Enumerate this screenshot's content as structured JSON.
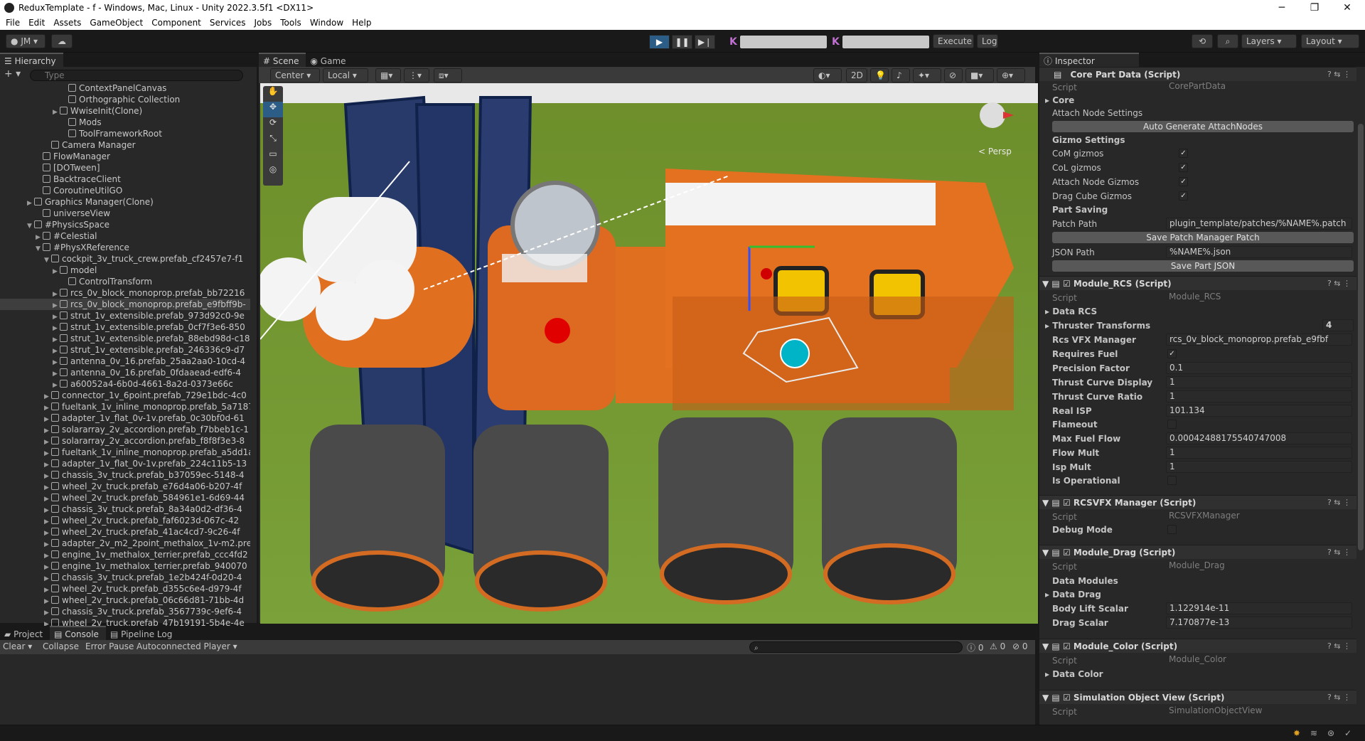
{
  "window": {
    "title": "ReduxTemplate - f - Windows, Mac, Linux - Unity 2022.3.5f1 <DX11>"
  },
  "menu": [
    "File",
    "Edit",
    "Assets",
    "GameObject",
    "Component",
    "Services",
    "Jobs",
    "Tools",
    "Window",
    "Help"
  ],
  "toolbar": {
    "account": "JM ▾",
    "execute": "Execute",
    "log": "Log",
    "layers": "Layers",
    "layout": "Layout"
  },
  "hierarchy": {
    "title": "Hierarchy",
    "search_placeholder": "Type",
    "rows": [
      {
        "text": "ContextPanelCanvas",
        "indent": 7,
        "arrow": ""
      },
      {
        "text": "Orthographic Collection",
        "indent": 7,
        "arrow": ""
      },
      {
        "text": "WwiseInit(Clone)",
        "indent": 6,
        "arrow": "▶"
      },
      {
        "text": "Mods",
        "indent": 7,
        "arrow": ""
      },
      {
        "text": "ToolFrameworkRoot",
        "indent": 7,
        "arrow": ""
      },
      {
        "text": "Camera Manager",
        "indent": 5,
        "arrow": ""
      },
      {
        "text": "FlowManager",
        "indent": 4,
        "arrow": ""
      },
      {
        "text": "[DOTween]",
        "indent": 4,
        "arrow": ""
      },
      {
        "text": "BacktraceClient",
        "indent": 4,
        "arrow": ""
      },
      {
        "text": "CoroutineUtilGO",
        "indent": 4,
        "arrow": ""
      },
      {
        "text": "Graphics Manager(Clone)",
        "indent": 3,
        "arrow": "▶"
      },
      {
        "text": "universeView",
        "indent": 4,
        "arrow": ""
      },
      {
        "text": "#PhysicsSpace",
        "indent": 3,
        "arrow": "▼"
      },
      {
        "text": "#Celestial",
        "indent": 4,
        "arrow": "▶"
      },
      {
        "text": "#PhysXReference",
        "indent": 4,
        "arrow": "▼"
      },
      {
        "text": "cockpit_3v_truck_crew.prefab_cf2457e7-f1",
        "indent": 5,
        "arrow": "▼"
      },
      {
        "text": "model",
        "indent": 6,
        "arrow": "▶"
      },
      {
        "text": "ControlTransform",
        "indent": 7,
        "arrow": ""
      },
      {
        "text": "rcs_0v_block_monoprop.prefab_bb72216",
        "indent": 6,
        "arrow": "▶"
      },
      {
        "text": "rcs_0v_block_monoprop.prefab_e9fbff9b-",
        "indent": 6,
        "arrow": "▶",
        "selected": true
      },
      {
        "text": "strut_1v_extensible.prefab_973d92c0-9e",
        "indent": 6,
        "arrow": "▶"
      },
      {
        "text": "strut_1v_extensible.prefab_0cf7f3e6-850",
        "indent": 6,
        "arrow": "▶"
      },
      {
        "text": "strut_1v_extensible.prefab_88ebd98d-c18",
        "indent": 6,
        "arrow": "▶"
      },
      {
        "text": "strut_1v_extensible.prefab_246336c9-d7",
        "indent": 6,
        "arrow": "▶"
      },
      {
        "text": "antenna_0v_16.prefab_25aa2aa0-10cd-4",
        "indent": 6,
        "arrow": "▶"
      },
      {
        "text": "antenna_0v_16.prefab_0fdaaead-edf6-4",
        "indent": 6,
        "arrow": "▶"
      },
      {
        "text": "a60052a4-6b0d-4661-8a2d-0373e66c",
        "indent": 6,
        "arrow": "▶"
      },
      {
        "text": "connector_1v_6point.prefab_729e1bdc-4c0",
        "indent": 5,
        "arrow": "▶"
      },
      {
        "text": "fueltank_1v_inline_monoprop.prefab_5a7187",
        "indent": 5,
        "arrow": "▶"
      },
      {
        "text": "adapter_1v_flat_0v-1v.prefab_0c30bf0d-61",
        "indent": 5,
        "arrow": "▶"
      },
      {
        "text": "solararray_2v_accordion.prefab_f7bbeb1c-1",
        "indent": 5,
        "arrow": "▶"
      },
      {
        "text": "solararray_2v_accordion.prefab_f8f8f3e3-8",
        "indent": 5,
        "arrow": "▶"
      },
      {
        "text": "fueltank_1v_inline_monoprop.prefab_a5dd1a",
        "indent": 5,
        "arrow": "▶"
      },
      {
        "text": "adapter_1v_flat_0v-1v.prefab_224c11b5-13",
        "indent": 5,
        "arrow": "▶"
      },
      {
        "text": "chassis_3v_truck.prefab_b37059ec-5148-4",
        "indent": 5,
        "arrow": "▶"
      },
      {
        "text": "wheel_2v_truck.prefab_e76d4a06-b207-4f",
        "indent": 5,
        "arrow": "▶"
      },
      {
        "text": "wheel_2v_truck.prefab_584961e1-6d69-44",
        "indent": 5,
        "arrow": "▶"
      },
      {
        "text": "chassis_3v_truck.prefab_8a34a0d2-df36-4",
        "indent": 5,
        "arrow": "▶"
      },
      {
        "text": "wheel_2v_truck.prefab_faf6023d-067c-42",
        "indent": 5,
        "arrow": "▶"
      },
      {
        "text": "wheel_2v_truck.prefab_41ac4cd7-9c26-4f",
        "indent": 5,
        "arrow": "▶"
      },
      {
        "text": "adapter_2v_m2_2point_methalox_1v-m2.pre",
        "indent": 5,
        "arrow": "▶"
      },
      {
        "text": "engine_1v_methalox_terrier.prefab_ccc4fd2",
        "indent": 5,
        "arrow": "▶"
      },
      {
        "text": "engine_1v_methalox_terrier.prefab_940070",
        "indent": 5,
        "arrow": "▶"
      },
      {
        "text": "chassis_3v_truck.prefab_1e2b424f-0d20-4",
        "indent": 5,
        "arrow": "▶"
      },
      {
        "text": "wheel_2v_truck.prefab_d355c6e4-d979-4f",
        "indent": 5,
        "arrow": "▶"
      },
      {
        "text": "wheel_2v_truck.prefab_06c66d81-71bb-4d",
        "indent": 5,
        "arrow": "▶"
      },
      {
        "text": "chassis_3v_truck.prefab_3567739c-9ef6-4",
        "indent": 5,
        "arrow": "▶"
      },
      {
        "text": "wheel_2v_truck.prefab_47b19191-5b4e-4e",
        "indent": 5,
        "arrow": "▶"
      }
    ]
  },
  "scene": {
    "tabs": [
      "Scene",
      "Game"
    ],
    "pivot": "Center",
    "space": "Local",
    "mode2d": "2D",
    "persp": "< Persp"
  },
  "bottom": {
    "tabs": [
      "Project",
      "Console",
      "Pipeline Log"
    ],
    "clear": "Clear",
    "collapse": "Collapse",
    "error_pause": "Error Pause",
    "player": "Autoconnected Player",
    "counts": [
      "0",
      "0",
      "0"
    ]
  },
  "inspector": {
    "title": "Inspector",
    "core": {
      "header": "Core Part Data (Script)",
      "script_label": "Script",
      "script": "CorePartData",
      "core": "Core",
      "attach": "Attach Node Settings",
      "auto_btn": "Auto Generate AttachNodes",
      "gizmo": "Gizmo Settings",
      "com": "CoM gizmos",
      "col": "CoL gizmos",
      "attachg": "Attach Node Gizmos",
      "dragc": "Drag Cube Gizmos",
      "saving": "Part Saving",
      "patch_label": "Patch Path",
      "patch": "plugin_template/patches/%NAME%.patch",
      "save_patch": "Save Patch Manager Patch",
      "json_label": "JSON Path",
      "json": "%NAME%.json",
      "save_json": "Save Part JSON"
    },
    "rcs": {
      "header": "Module_RCS (Script)",
      "script": "Module_RCS",
      "data": "Data RCS",
      "thr_label": "Thruster Transforms",
      "thr": "4",
      "vfx_label": "Rcs VFX Manager",
      "vfx": "rcs_0v_block_monoprop.prefab_e9fbf",
      "req": "Requires Fuel",
      "prec_label": "Precision Factor",
      "prec": "0.1",
      "tcd_label": "Thrust Curve Display",
      "tcd": "1",
      "tcr_label": "Thrust Curve Ratio",
      "tcr": "1",
      "isp_label": "Real ISP",
      "isp": "101.134",
      "flame": "Flameout",
      "mff_label": "Max Fuel Flow",
      "mff": "0.00042488175540747008",
      "fm_label": "Flow Mult",
      "fm": "1",
      "im_label": "Isp Mult",
      "im": "1",
      "op": "Is Operational"
    },
    "vfx": {
      "header": "RCSVFX Manager (Script)",
      "script": "RCSVFXManager",
      "debug": "Debug Mode"
    },
    "drag": {
      "header": "Module_Drag (Script)",
      "script": "Module_Drag",
      "modules": "Data Modules",
      "data": "Data Drag",
      "bl_label": "Body Lift Scalar",
      "bl": "1.122914e-11",
      "ds_label": "Drag Scalar",
      "ds": "7.170877e-13"
    },
    "color": {
      "header": "Module_Color (Script)",
      "script": "Module_Color",
      "data": "Data Color"
    },
    "sim": {
      "header": "Simulation Object View (Script)",
      "script": "SimulationObjectView"
    }
  }
}
